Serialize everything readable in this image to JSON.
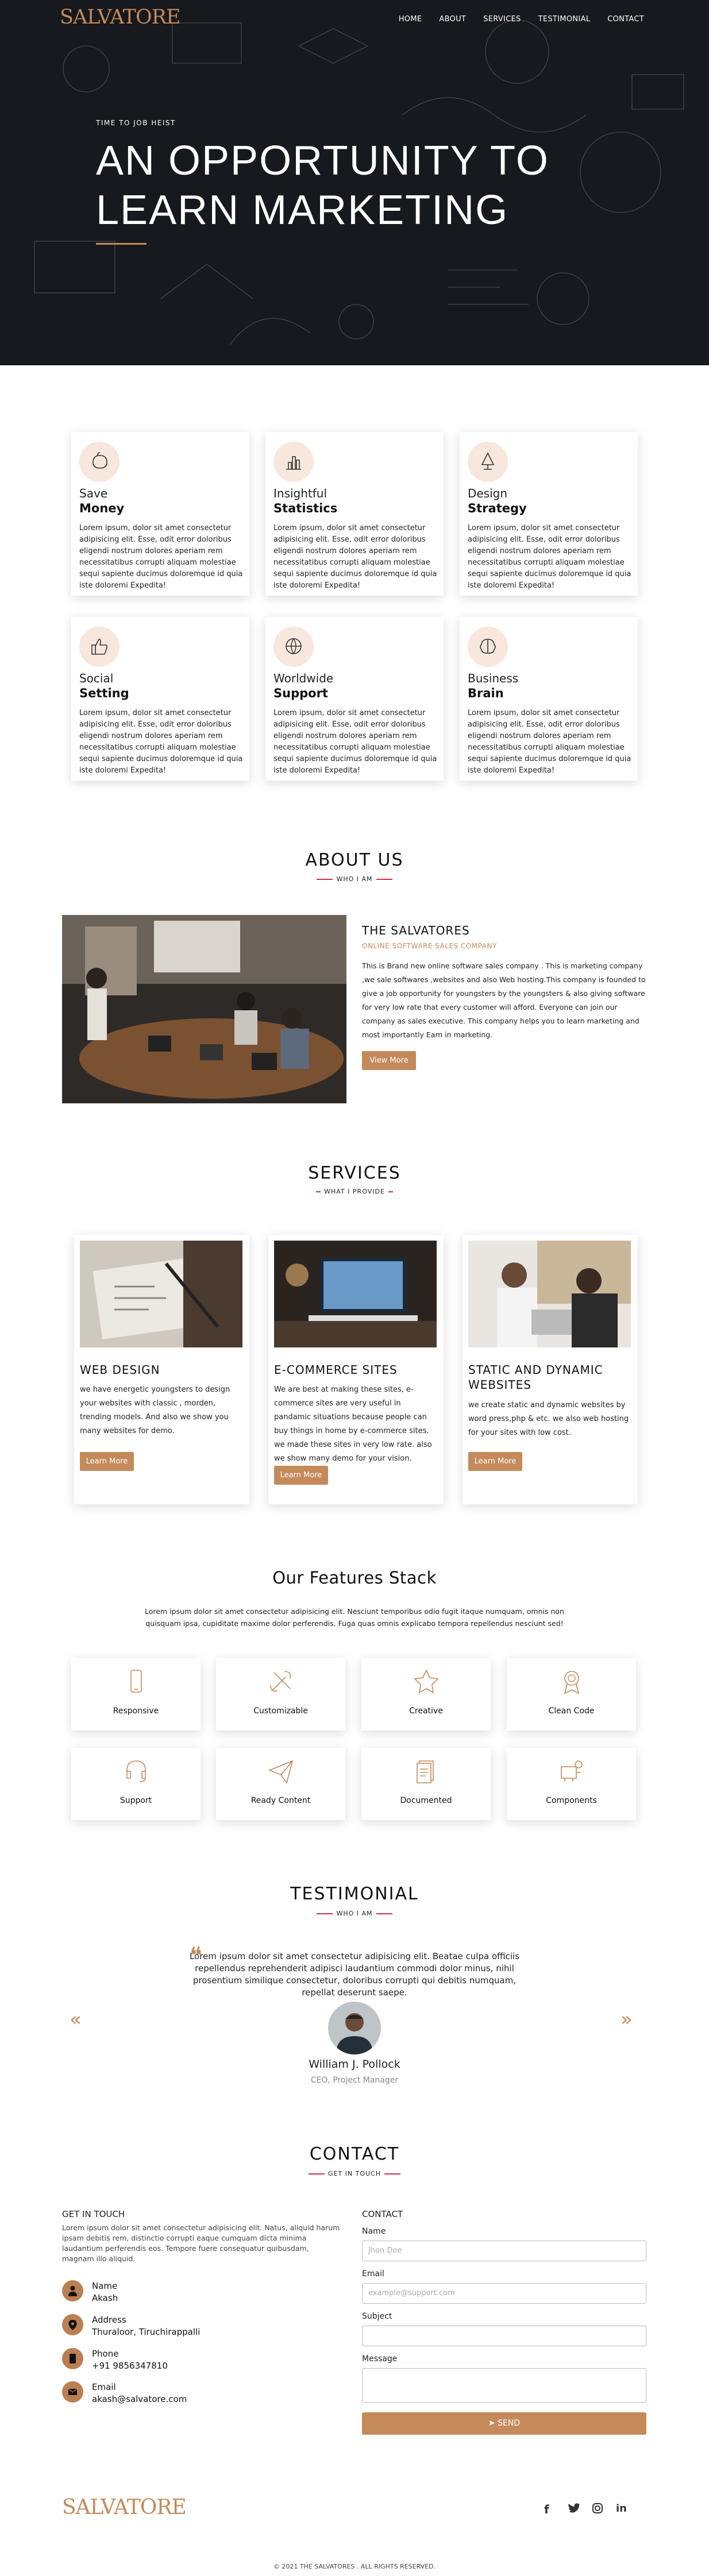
{
  "header": {
    "logo": "SALVATORE",
    "nav": [
      "HOME",
      "ABOUT",
      "SERVICES",
      "TESTIMONIAL",
      "CONTACT"
    ]
  },
  "hero": {
    "kicker": "TIME TO JOB HEIST",
    "title": "AN OPPORTUNITY TO LEARN MARKETING"
  },
  "cards": [
    {
      "t1": "Save",
      "t2": "Money",
      "icon": "piggy-bank-icon",
      "text": "Lorem ipsum, dolor sit amet consectetur adipisicing elit. Esse, odit error doloribus eligendi nostrum dolores aperiam rem necessitatibus corrupti aliquam molestiae sequi sapiente ducimus doloremque id quia iste doloremi Expedita!"
    },
    {
      "t1": "Insightful",
      "t2": "Statistics",
      "icon": "bar-chart-icon",
      "text": "Lorem ipsum, dolor sit amet consectetur adipisicing elit. Esse, odit error doloribus eligendi nostrum dolores aperiam rem necessitatibus corrupti aliquam molestiae sequi sapiente ducimus doloremque id quia iste doloremi Expedita!"
    },
    {
      "t1": "Design",
      "t2": "Strategy",
      "icon": "design-icon",
      "text": "Lorem ipsum, dolor sit amet consectetur adipisicing elit. Esse, odit error doloribus eligendi nostrum dolores aperiam rem necessitatibus corrupti aliquam molestiae sequi sapiente ducimus doloremque id quia iste doloremi Expedita!"
    },
    {
      "t1": "Social",
      "t2": "Setting",
      "icon": "thumbs-up-icon",
      "text": "Lorem ipsum, dolor sit amet consectetur adipisicing elit. Esse, odit error doloribus eligendi nostrum dolores aperiam rem necessitatibus corrupti aliquam molestiae sequi sapiente ducimus doloremque id quia iste doloremi Expedita!"
    },
    {
      "t1": "Worldwide",
      "t2": "Support",
      "icon": "globe-icon",
      "text": "Lorem ipsum, dolor sit amet consectetur adipisicing elit. Esse, odit error doloribus eligendi nostrum dolores aperiam rem necessitatibus corrupti aliquam molestiae sequi sapiente ducimus doloremque id quia iste doloremi Expedita!"
    },
    {
      "t1": "Business",
      "t2": "Brain",
      "icon": "brain-icon",
      "text": "Lorem ipsum, dolor sit amet consectetur adipisicing elit. Esse, odit error doloribus eligendi nostrum dolores aperiam rem necessitatibus corrupti aliquam molestiae sequi sapiente ducimus doloremque id quia iste doloremi Expedita!"
    }
  ],
  "about": {
    "title": "ABOUT US",
    "sub": "WHO I AM",
    "name": "THE SALVATORES",
    "tagline": "ONLINE SOFTWARE SALES COMPANY",
    "text": "This is Brand new online software sales company . This is marketing company ,we sale softwares ,websites and also Web hosting.This company is founded to give a job opportunity for youngsters by the youngsters & also giving software for very low rate that every customer will afford. Everyone can join our company as sales executive. This company helps you to learn marketing and most importantly Earn in marketing.",
    "button": "View More"
  },
  "services": {
    "title": "SERVICES",
    "sub": "WHAT I PROVIDE",
    "items": [
      {
        "title": "WEB DESIGN",
        "text": "we have energetic youngsters to design your websites with classic , morden, trending models. And also we show you many websites for demo.",
        "button": "Learn More"
      },
      {
        "title": "E-COMMERCE SITES",
        "text": "We are best at making these sites, e-commerce sites are very useful in pandamic situations because people can buy things in home by e-commerce sites. we made these sites in very low rate. also we show many demo for your vision.",
        "button": "Learn More"
      },
      {
        "title": "STATIC AND DYNAMIC WEBSITES",
        "text": "we create static and dynamic websites by word press,php & etc. we also web hosting for your sites with low cost.",
        "button": "Learn More"
      }
    ]
  },
  "features": {
    "title": "Our Features Stack",
    "text": "Lorem ipsum dolor sit amet consectetur adipisicing elit. Nesciunt temporibus odio fugit itaque numquam, omnis non quisquam ipsa, cupiditate maxime dolor perferendis. Fuga quas omnis explicabo tempora repellendus nesciunt sed!",
    "items": [
      {
        "label": "Responsive",
        "icon": "mobile-icon"
      },
      {
        "label": "Customizable",
        "icon": "tools-icon"
      },
      {
        "label": "Creative",
        "icon": "star-icon"
      },
      {
        "label": "Clean Code",
        "icon": "award-icon"
      },
      {
        "label": "Support",
        "icon": "headset-icon"
      },
      {
        "label": "Ready Content",
        "icon": "paper-plane-icon"
      },
      {
        "label": "Documented",
        "icon": "document-icon"
      },
      {
        "label": "Components",
        "icon": "components-icon"
      }
    ]
  },
  "testimonial": {
    "title": "TESTIMONIAL",
    "sub": "WHO I AM",
    "quote": "Lorem ipsum dolor sit amet consectetur adipisicing elit. Beatae culpa officiis repellendus reprehenderit adipisci laudantium commodi dolor minus, nihil prosentium similique consectetur, doloribus corrupti qui debitis numquam, repellat deserunt saepe.",
    "name": "William J. Pollock",
    "role": "CEO, Project Manager"
  },
  "contact": {
    "title": "CONTACT",
    "sub": "GET IN TOUCH",
    "left_title": "GET IN TOUCH",
    "left_text": "Lorem ipsum dolor sit amet consectetur adipisicing elit. Natus, aliquid harum ipsam debitis rem, distinctio corrupti eaque cumquam dicta minima laudantium perferendis eos. Tempore fuere consequatur quibusdam, magnam illo aliquid.",
    "info": [
      {
        "label": "Name",
        "value": "Akash",
        "icon": "user-icon"
      },
      {
        "label": "Address",
        "value": "Thuraloor, Tiruchirappalli",
        "icon": "location-icon"
      },
      {
        "label": "Phone",
        "value": "+91 9856347810",
        "icon": "phone-icon"
      },
      {
        "label": "Email",
        "value": "akash@salvatore.com",
        "icon": "mail-icon"
      }
    ],
    "form_title": "CONTACT",
    "name_label": "Name",
    "name_ph": "Jhon Doe",
    "email_label": "Email",
    "email_ph": "example@support.com",
    "subject_label": "Subject",
    "message_label": "Message",
    "send": "SEND"
  },
  "footer": {
    "logo": "SALVATORE",
    "copyright": "© 2021 THE SALVATORES . ALL RIGHTS RESERVED.",
    "social": [
      "facebook-icon",
      "twitter-icon",
      "instagram-icon",
      "linkedin-icon"
    ]
  },
  "colors": {
    "accent": "#c48a5a",
    "hero_bg": "#16191d",
    "accent_line": "#c9324c"
  }
}
